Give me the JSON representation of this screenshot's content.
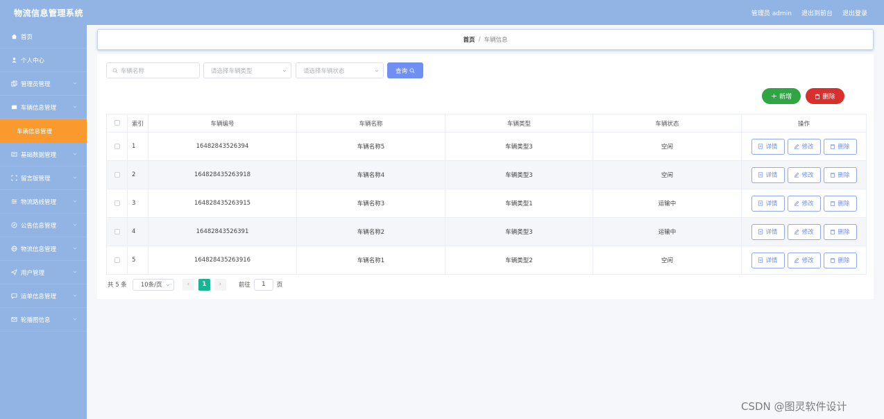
{
  "app": {
    "title": "物流信息管理系统",
    "user_label": "管理员 admin",
    "to_front": "退出到前台",
    "logout": "退出登录"
  },
  "sidebar": {
    "items": [
      {
        "label": "首页",
        "icon": "home-icon"
      },
      {
        "label": "个人中心",
        "icon": "user-icon"
      },
      {
        "label": "管理员管理",
        "icon": "copy-icon"
      },
      {
        "label": "车辆信息管理",
        "icon": "card-icon"
      },
      {
        "label": "车辆信息管理",
        "icon": "",
        "sub": true
      },
      {
        "label": "基础数据管理",
        "icon": "id-card-icon"
      },
      {
        "label": "留言版管理",
        "icon": "fullscreen-icon"
      },
      {
        "label": "物流路线管理",
        "icon": "sliders-icon"
      },
      {
        "label": "公告信息管理",
        "icon": "compass-icon"
      },
      {
        "label": "物流信息管理",
        "icon": "globe-icon"
      },
      {
        "label": "用户管理",
        "icon": "send-icon"
      },
      {
        "label": "运单信息管理",
        "icon": "chat-icon"
      },
      {
        "label": "轮播图信息",
        "icon": "mail-icon"
      }
    ]
  },
  "breadcrumb": {
    "home": "首页",
    "separator": "/",
    "current": "车辆信息"
  },
  "search": {
    "name_placeholder": "车辆名称",
    "type_placeholder": "请选择车辆类型",
    "status_placeholder": "请选择车辆状态",
    "query_label": "查询"
  },
  "actions": {
    "add_label": "新增",
    "delete_label": "删除"
  },
  "table": {
    "headers": {
      "index": "索引",
      "number": "车辆编号",
      "name": "车辆名称",
      "type": "车辆类型",
      "status": "车辆状态",
      "ops": "操作"
    },
    "row_actions": {
      "detail": "详情",
      "edit": "修改",
      "delete": "删除"
    },
    "rows": [
      {
        "index": "1",
        "number": "16482843526394",
        "name": "车辆名称5",
        "type": "车辆类型3",
        "status": "空闲"
      },
      {
        "index": "2",
        "number": "164828435263918",
        "name": "车辆名称4",
        "type": "车辆类型3",
        "status": "空闲"
      },
      {
        "index": "3",
        "number": "164828435263915",
        "name": "车辆名称3",
        "type": "车辆类型1",
        "status": "运输中"
      },
      {
        "index": "4",
        "number": "16482843526391",
        "name": "车辆名称2",
        "type": "车辆类型3",
        "status": "运输中"
      },
      {
        "index": "5",
        "number": "164828435263916",
        "name": "车辆名称1",
        "type": "车辆类型2",
        "status": "空闲"
      }
    ]
  },
  "pagination": {
    "total": "共 5 条",
    "page_size": "10条/页",
    "prev": "‹",
    "current": "1",
    "next": "›",
    "goto_label": "前往",
    "goto_value": "1",
    "page_suffix": "页"
  },
  "watermark": "CSDN @图灵软件设计",
  "colors": {
    "header_bg": "#92b4e4",
    "active_menu": "#fa9a2e",
    "primary": "#6f8ff3",
    "success": "#2fa544",
    "danger": "#d9302e",
    "page_active": "#1ab394"
  }
}
